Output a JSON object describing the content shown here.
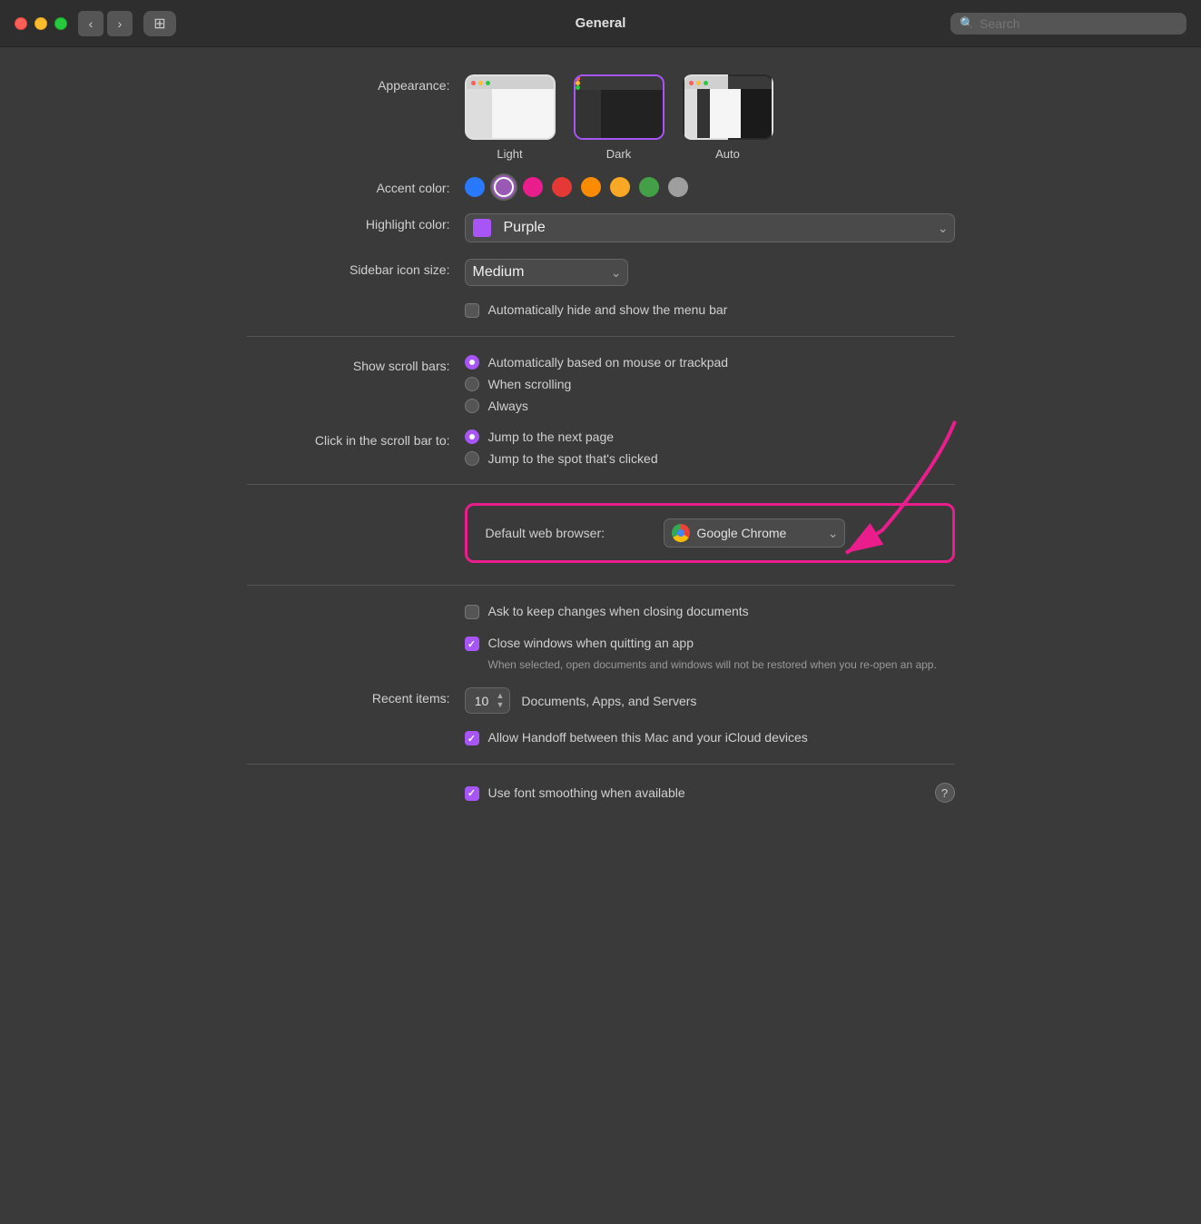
{
  "titlebar": {
    "title": "General",
    "search_placeholder": "Search",
    "back_label": "‹",
    "forward_label": "›",
    "grid_label": "⊞"
  },
  "appearance": {
    "label": "Appearance:",
    "options": [
      {
        "id": "light",
        "label": "Light",
        "selected": false
      },
      {
        "id": "dark",
        "label": "Dark",
        "selected": true
      },
      {
        "id": "auto",
        "label": "Auto",
        "selected": false
      }
    ]
  },
  "accent_color": {
    "label": "Accent color:",
    "colors": [
      {
        "id": "blue",
        "color": "#2979ff",
        "selected": false
      },
      {
        "id": "purple",
        "color": "#9b59b6",
        "selected": true
      },
      {
        "id": "pink",
        "color": "#e91e8c",
        "selected": false
      },
      {
        "id": "red",
        "color": "#e53935",
        "selected": false
      },
      {
        "id": "orange",
        "color": "#fb8c00",
        "selected": false
      },
      {
        "id": "yellow",
        "color": "#f9a825",
        "selected": false
      },
      {
        "id": "green",
        "color": "#43a047",
        "selected": false
      },
      {
        "id": "graphite",
        "color": "#9e9e9e",
        "selected": false
      }
    ]
  },
  "highlight_color": {
    "label": "Highlight color:",
    "value": "Purple",
    "swatch": "#a855f7"
  },
  "sidebar_icon_size": {
    "label": "Sidebar icon size:",
    "value": "Medium"
  },
  "menu_bar": {
    "label": "",
    "checkbox_label": "Automatically hide and show the menu bar",
    "checked": false
  },
  "show_scroll_bars": {
    "label": "Show scroll bars:",
    "options": [
      {
        "id": "auto",
        "label": "Automatically based on mouse or trackpad",
        "selected": true
      },
      {
        "id": "scrolling",
        "label": "When scrolling",
        "selected": false
      },
      {
        "id": "always",
        "label": "Always",
        "selected": false
      }
    ]
  },
  "click_scroll_bar": {
    "label": "Click in the scroll bar to:",
    "options": [
      {
        "id": "next-page",
        "label": "Jump to the next page",
        "selected": true
      },
      {
        "id": "spot-clicked",
        "label": "Jump to the spot that's clicked",
        "selected": false
      }
    ]
  },
  "default_browser": {
    "label": "Default web browser:",
    "value": "Google Chrome"
  },
  "ask_keep_changes": {
    "label": "Ask to keep changes when closing documents",
    "checked": false
  },
  "close_windows": {
    "label": "Close windows when quitting an app",
    "checked": true,
    "subtitle": "When selected, open documents and windows will not be restored\nwhen you re-open an app."
  },
  "recent_items": {
    "label": "Recent items:",
    "value": "10",
    "suffix": "Documents, Apps, and Servers"
  },
  "allow_handoff": {
    "label": "Allow Handoff between this Mac and your iCloud devices",
    "checked": true
  },
  "font_smoothing": {
    "label": "Use font smoothing when available",
    "checked": true
  }
}
